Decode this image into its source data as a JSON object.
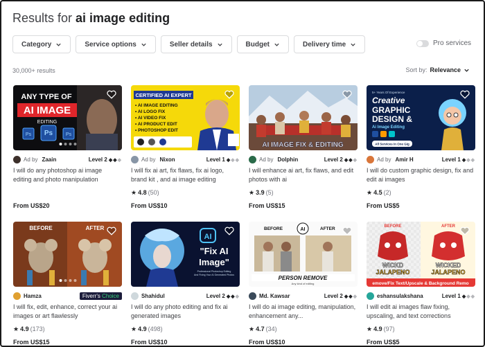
{
  "header": {
    "title_prefix": "Results for ",
    "query": "ai image editing"
  },
  "filters": [
    {
      "label": "Category"
    },
    {
      "label": "Service options"
    },
    {
      "label": "Seller details"
    },
    {
      "label": "Budget"
    },
    {
      "label": "Delivery time"
    }
  ],
  "pro_services": {
    "label": "Pro services",
    "enabled": false
  },
  "results_count": "30,000+ results",
  "sort": {
    "prefix": "Sort by:",
    "value": "Relevance"
  },
  "gigs": [
    {
      "ad": "Ad by",
      "seller": "Zaain",
      "level": "Level 2",
      "title": "I will do any photoshop ai image editing and photo manipulation",
      "rating": "",
      "reviews": "",
      "price": "From US$20",
      "thumb": {
        "lines": [
          "ANY TYPE OF",
          "AI IMAGE",
          "EDITING"
        ],
        "accent": "#e0262b"
      }
    },
    {
      "ad": "Ad by",
      "seller": "Nixon",
      "level": "Level 1",
      "title": "I will fix ai art, fix flaws, fix ai logo, brand kit , and ai image editing",
      "rating": "4.8",
      "reviews": "(50)",
      "price": "From US$10",
      "thumb": {
        "lines": [
          "CERTIFIED AI EXPERT",
          "• AI  IMAGE  EDITING",
          "• AI  LOGO  FIX",
          "• AI  VIDEO  FIX",
          "• AI  PRODUCT  EDIT",
          "• PHOTOSHOP EDIT"
        ],
        "accent": "#f5d90a"
      }
    },
    {
      "ad": "Ad by",
      "seller": "Dolphin",
      "level": "Level 2",
      "title": "I will enhance ai art, fix flaws, and edit photos with ai",
      "rating": "3.9",
      "reviews": "(5)",
      "price": "From US$15",
      "thumb": {
        "lines": [
          "AI IMAGE FIX & EDITING"
        ],
        "accent": "#c7d7e8"
      }
    },
    {
      "ad": "Ad by",
      "seller": "Amir H",
      "level": "Level 1",
      "title": "I will do custom graphic design, fix and edit ai images",
      "rating": "4.5",
      "reviews": "(2)",
      "price": "From US$5",
      "thumb": {
        "lines": [
          "5+ Years Of Experience",
          "Creative",
          "GRAPHIC",
          "DESIGN &",
          "Ai Image Editing",
          "All Services In One Gig"
        ],
        "accent": "#7ad3ff"
      }
    },
    {
      "ad": "",
      "seller": "Hamza",
      "level": "",
      "badge": "Fiverr's Choice",
      "title": "I will fix, edit, enhance, correct your ai images or art flawlessly",
      "rating": "4.9",
      "reviews": "(173)",
      "price": "From US$15",
      "thumb": {
        "lines": [
          "BEFORE",
          "AFTER"
        ],
        "accent": "#f0c04a"
      }
    },
    {
      "ad": "",
      "seller": "Shahidul",
      "level": "Level 2",
      "title": "I will do any photo editing and fix ai generated images",
      "rating": "4.9",
      "reviews": "(498)",
      "price": "From US$10",
      "thumb": {
        "lines": [
          "AI",
          "\"Fix AI",
          "Image\"",
          "Professional Photoshop Editing",
          "And Fixing Your AI Generated Photos"
        ],
        "accent": "#4fc3f7"
      }
    },
    {
      "ad": "",
      "seller": "Md. Kawsar",
      "level": "Level 2",
      "title": "I will do ai image editing, manipulation, enhancement any...",
      "rating": "4.7",
      "reviews": "(34)",
      "price": "From US$10",
      "thumb": {
        "lines": [
          "BEFORE",
          "AFTER",
          "AI",
          "PERSON REMOVE",
          "Any kind of editing"
        ],
        "accent": "#111"
      }
    },
    {
      "ad": "",
      "seller": "eshansulakshana",
      "level": "Level 1",
      "title": "I will edit ai images flaw fixing, upscaling, and text corrections",
      "rating": "4.9",
      "reviews": "(97)",
      "price": "From US$5",
      "thumb": {
        "lines": [
          "BEFORE",
          "AFTER",
          "WICKD",
          "JALAPENO",
          "WICKED",
          "JALAPENO",
          "emove/Fix Text/Upscale & Background Remo"
        ],
        "accent": "#e53935"
      }
    }
  ]
}
